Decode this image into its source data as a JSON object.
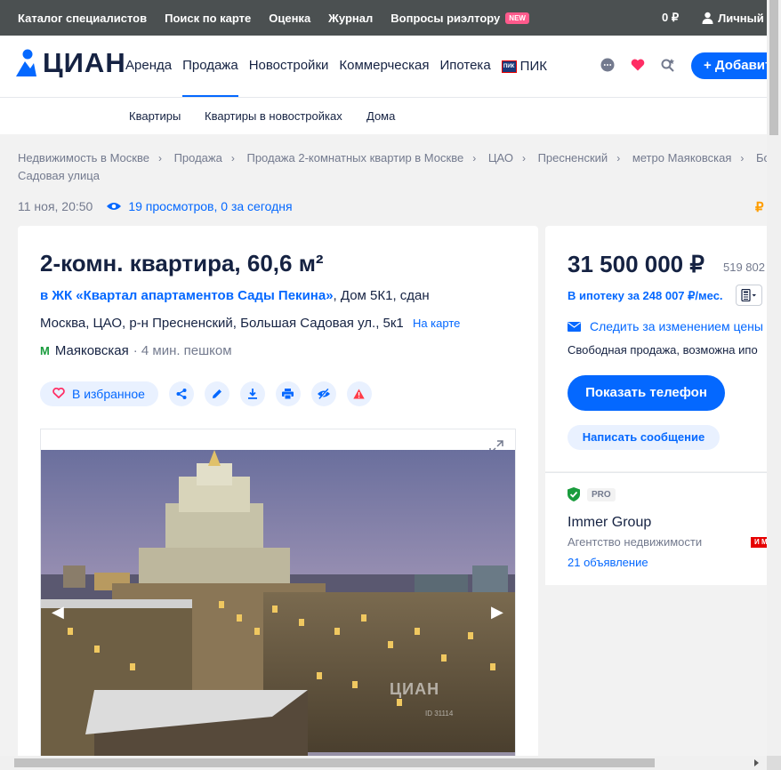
{
  "topbar": {
    "links": [
      "Каталог специалистов",
      "Поиск по карте",
      "Оценка",
      "Журнал",
      "Вопросы риэлтору"
    ],
    "new_badge": "NEW",
    "balance": "0 ₽",
    "account": "Личный к"
  },
  "header": {
    "logo_text": "ЦИАН",
    "nav": [
      "Аренда",
      "Продажа",
      "Новостройки",
      "Коммерческая",
      "Ипотека"
    ],
    "pik_label": "ПИК",
    "pik_badge": "ПИК",
    "add_button": "+ Добавит"
  },
  "subnav": [
    "Квартиры",
    "Квартиры в новостройках",
    "Дома"
  ],
  "breadcrumbs": {
    "row1": [
      "Недвижимость в Москве",
      "Продажа",
      "Продажа 2-комнатных квартир в Москве",
      "ЦАО",
      "Пресненский",
      "метро Маяковская",
      "Бол"
    ],
    "row2": "Садовая улица"
  },
  "meta": {
    "date": "11 ноя, 20:50",
    "views": "19 просмотров, 0 за сегодня",
    "ruble": "₽"
  },
  "listing": {
    "title": "2-комн. квартира, 60,6 м²",
    "zhk_link": "в ЖК «Квартал апартаментов Сады Пекина»",
    "zhk_rest": ", Дом 5К1, сдан",
    "address": "Москва, ЦАО, р-н Пресненский, Большая Садовая ул., 5к1",
    "map_link": "На карте",
    "metro_icon": "М",
    "metro": "Маяковская",
    "walk": "· 4 мин. пешком",
    "fav_button": "В избранное",
    "watermark": "ЦИАН",
    "watermark_id": "ID 31114"
  },
  "price_block": {
    "price": "31 500 000 ₽",
    "price_m2": "519 802",
    "mortgage": "В ипотеку за 248 007 ₽/мес.",
    "follow": "Следить за изменением цены",
    "sale_type": "Свободная продажа, возможна ипо",
    "phone_button": "Показать телефон",
    "message_button": "Написать сообщение"
  },
  "agent": {
    "pro": "PRO",
    "name": "Immer Group",
    "type": "Агентство недвижимости",
    "red_badge": "И М",
    "count": "21 объявление"
  },
  "colors": {
    "accent": "#0468ff",
    "topbar": "#4b5051",
    "text": "#152242",
    "muted": "#737a8e"
  }
}
